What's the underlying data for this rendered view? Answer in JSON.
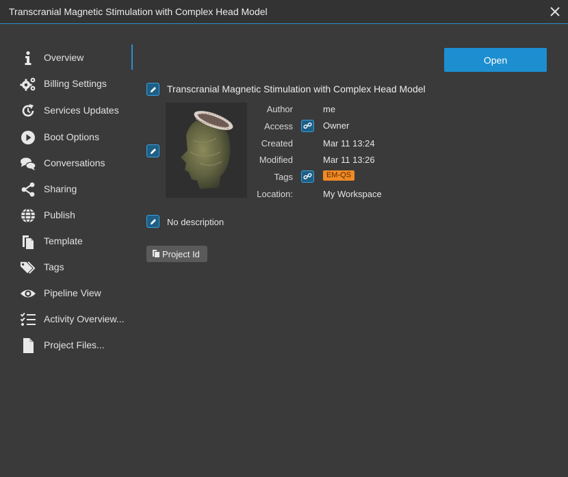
{
  "window": {
    "title": "Transcranial Magnetic Stimulation with Complex Head Model"
  },
  "sidebar": {
    "items": [
      {
        "label": "Overview",
        "icon": "info-icon",
        "active": true
      },
      {
        "label": "Billing Settings",
        "icon": "gears-icon"
      },
      {
        "label": "Services Updates",
        "icon": "refresh-icon"
      },
      {
        "label": "Boot Options",
        "icon": "play-icon"
      },
      {
        "label": "Conversations",
        "icon": "chat-icon"
      },
      {
        "label": "Sharing",
        "icon": "share-icon"
      },
      {
        "label": "Publish",
        "icon": "globe-icon"
      },
      {
        "label": "Template",
        "icon": "copy-icon"
      },
      {
        "label": "Tags",
        "icon": "tags-icon"
      },
      {
        "label": "Pipeline View",
        "icon": "eye-icon"
      },
      {
        "label": "Activity Overview...",
        "icon": "checklist-icon"
      },
      {
        "label": "Project Files...",
        "icon": "file-icon"
      }
    ]
  },
  "main": {
    "open_label": "Open",
    "project_name": "Transcranial Magnetic Stimulation with Complex Head Model",
    "meta": {
      "author_label": "Author",
      "author_value": "me",
      "access_label": "Access",
      "access_value": "Owner",
      "created_label": "Created",
      "created_value": "Mar 11 13:24",
      "modified_label": "Modified",
      "modified_value": "Mar 11 13:26",
      "tags_label": "Tags",
      "tag_value": "EM-QS",
      "location_label": "Location:",
      "location_value": "My Workspace"
    },
    "description": "No description",
    "project_id_label": "Project Id"
  },
  "colors": {
    "accent": "#1d8ed0",
    "tag": "#f08a24",
    "background": "#3a3a3a"
  }
}
